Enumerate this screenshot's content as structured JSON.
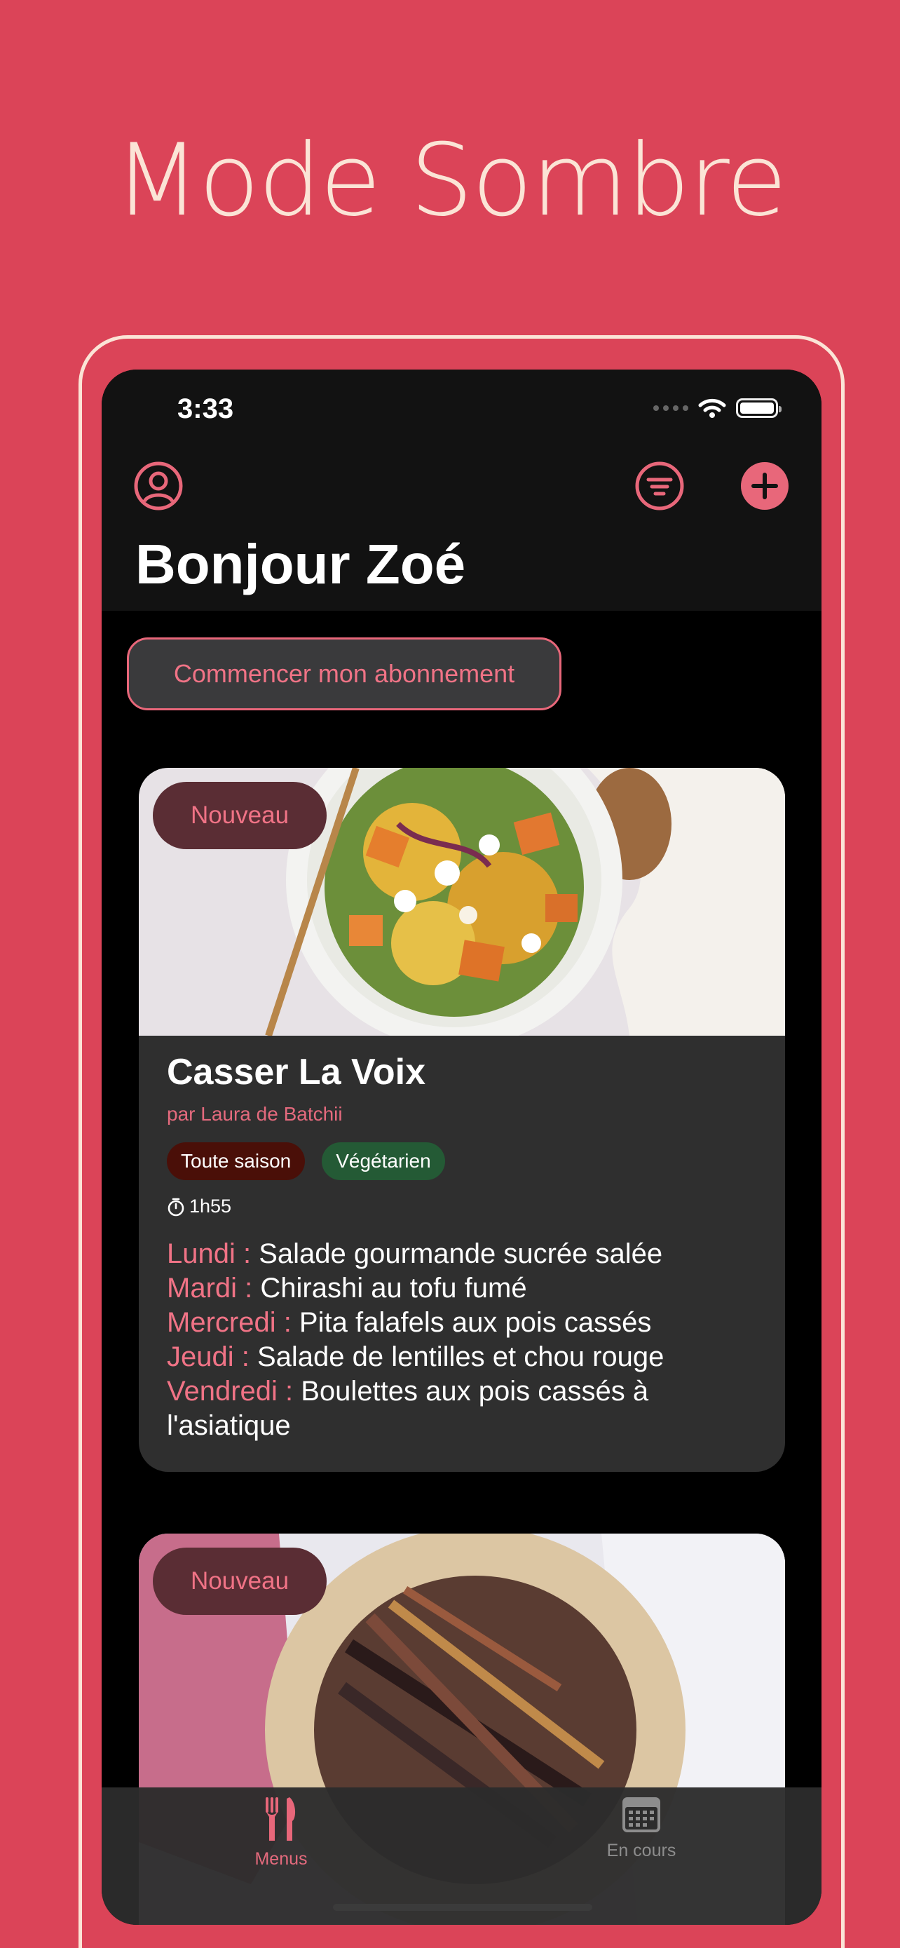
{
  "promo": {
    "title": "Mode Sombre"
  },
  "status_bar": {
    "time": "3:33"
  },
  "header": {
    "greeting": "Bonjour Zoé",
    "profile_icon": "person-circle-icon",
    "filter_icon": "filter-lines-icon",
    "add_icon": "plus-circle-icon"
  },
  "subscribe_button": {
    "label": "Commencer mon abonnement"
  },
  "cards": [
    {
      "badge": "Nouveau",
      "title": "Casser La Voix",
      "author": "par Laura de Batchii",
      "tags": [
        "Toute saison",
        "Végétarien"
      ],
      "duration": "1h55",
      "menu": [
        {
          "day": "Lundi :",
          "dish": " Salade gourmande sucrée salée"
        },
        {
          "day": "Mardi :",
          "dish": " Chirashi au tofu fumé"
        },
        {
          "day": "Mercredi :",
          "dish": " Pita falafels aux pois cassés"
        },
        {
          "day": "Jeudi :",
          "dish": " Salade de lentilles et chou rouge"
        },
        {
          "day": "Vendredi :",
          "dish": " Boulettes aux pois cassés à l'asiatique"
        }
      ]
    },
    {
      "badge": "Nouveau"
    }
  ],
  "tab_bar": {
    "tabs": [
      {
        "label": "Menus",
        "icon": "fork-knife-icon",
        "active": true
      },
      {
        "label": "En cours",
        "icon": "calendar-icon",
        "active": false
      }
    ]
  },
  "colors": {
    "background": "#DB4458",
    "accent": "#E8677A",
    "screen": "#000000",
    "card": "#2F2F2F"
  }
}
